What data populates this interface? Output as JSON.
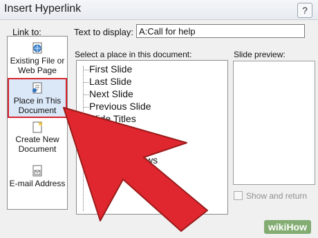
{
  "window": {
    "title": "Insert Hyperlink",
    "help_glyph": "?"
  },
  "link_to": {
    "label": "Link to:",
    "items": [
      {
        "label_line1": "Existing File or",
        "label_line2": "Web Page",
        "icon": "globe-icon"
      },
      {
        "label_line1": "Place in This",
        "label_line2": "Document",
        "icon": "document-place-icon",
        "selected": true
      },
      {
        "label_line1": "Create New",
        "label_line2": "Document",
        "icon": "new-document-icon"
      },
      {
        "label_line1": "E-mail Address",
        "label_line2": "",
        "icon": "email-icon"
      }
    ]
  },
  "text_to_display": {
    "label": "Text to display:",
    "value": "A:Call for help"
  },
  "select_place": {
    "label": "Select a place in this document:",
    "items": [
      "First Slide",
      "Last Slide",
      "Next Slide",
      "Previous Slide",
      "Slide Titles",
      "",
      "",
      "ws"
    ]
  },
  "slide_preview": {
    "label": "Slide preview:"
  },
  "show_and_return": {
    "label": "Show and return",
    "checked": false
  },
  "overlay": {
    "arrow_color": "#e0272f",
    "arrow_outline": "#9a1a1a"
  },
  "watermark": {
    "text": "wikiHow"
  }
}
